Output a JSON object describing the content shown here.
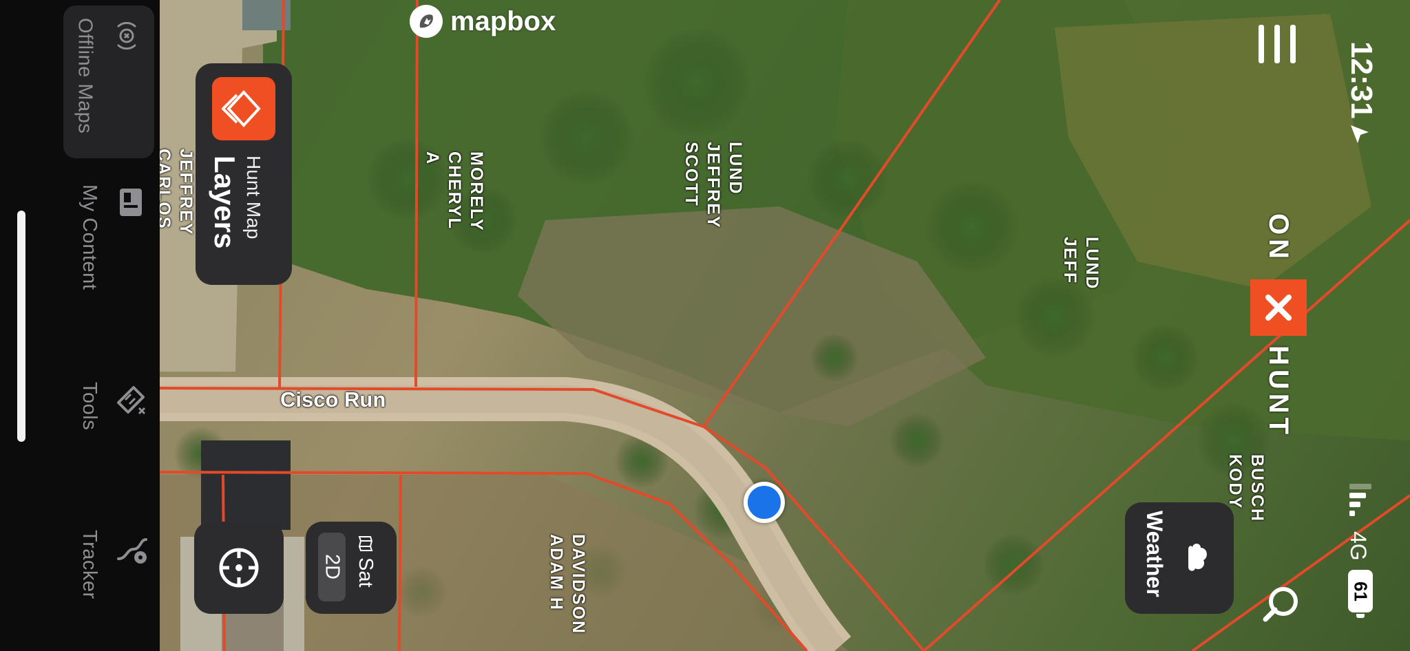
{
  "nav": {
    "items": [
      {
        "label": "Offline Maps",
        "icon": "offline-maps-icon",
        "selected": true
      },
      {
        "label": "My Content",
        "icon": "my-content-icon"
      },
      {
        "label": "Tools",
        "icon": "tools-icon"
      },
      {
        "label": "Tracker",
        "icon": "tracker-icon"
      }
    ]
  },
  "map": {
    "attribution": "mapbox",
    "road_label": "Cisco Run",
    "parcels": [
      {
        "owner": "JEFFREY\nCARLOS"
      },
      {
        "owner": "MORELY\nCHERYL\nA"
      },
      {
        "owner": "LUND\nJEFFREY\nSCOTT"
      },
      {
        "owner": "LUND\nJEFF"
      },
      {
        "owner": "BUSCH\nKODY"
      },
      {
        "owner": "DAVIDSON\nADAM H"
      }
    ],
    "boundary_color": "#e24a2a"
  },
  "controls": {
    "layers": {
      "title": "Layers",
      "subtitle": "Hunt Map",
      "icon": "layers-icon",
      "accent": "#f04e23"
    },
    "map_mode": {
      "primary": "Sat",
      "secondary": "2D"
    },
    "weather": {
      "label": "Weather",
      "icon": "weather-icon"
    },
    "locate": {
      "icon": "locate-icon"
    },
    "menu": {
      "icon": "menu-icon"
    },
    "search": {
      "icon": "search-icon"
    }
  },
  "brand": {
    "on": "ON",
    "hunt": "HUNT",
    "accent": "#f04e23"
  },
  "status": {
    "time": "12:31",
    "network": "4G",
    "battery": "61"
  }
}
